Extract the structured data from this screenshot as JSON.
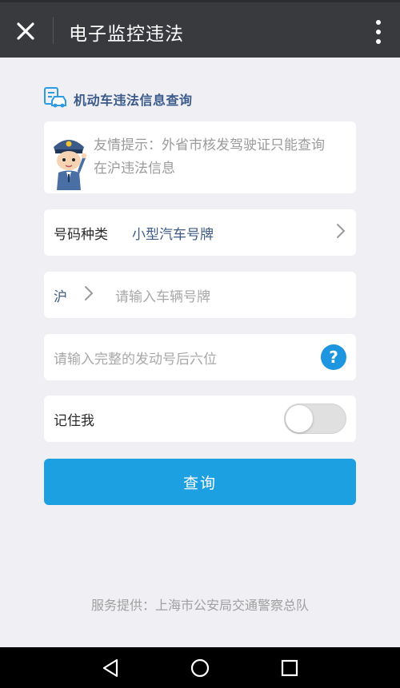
{
  "topbar": {
    "title": "电子监控违法",
    "close_icon": "close-icon",
    "more_icon": "more-vertical-icon"
  },
  "section": {
    "heading": "机动车违法信息查询",
    "icon": "car-document-icon"
  },
  "tip": {
    "text": "友情提示：外省市核发驾驶证只能查询 在沪违法信息",
    "mascot": "police-officer-avatar"
  },
  "plate_type": {
    "label": "号码种类",
    "value": "小型汽车号牌"
  },
  "plate_number": {
    "prefix": "沪",
    "placeholder": "请输入车辆号牌"
  },
  "engine_number": {
    "placeholder": "请输入完整的发动号后六位",
    "help_label": "?"
  },
  "remember": {
    "label": "记住我",
    "enabled": false
  },
  "query_button": {
    "label": "查询"
  },
  "footer": {
    "text": "服务提供：上海市公安局交通警察总队"
  },
  "colors": {
    "accent": "#1da0e2",
    "topbar": "#393a3e",
    "background": "#efeff4",
    "link_text": "#3d5b86"
  }
}
